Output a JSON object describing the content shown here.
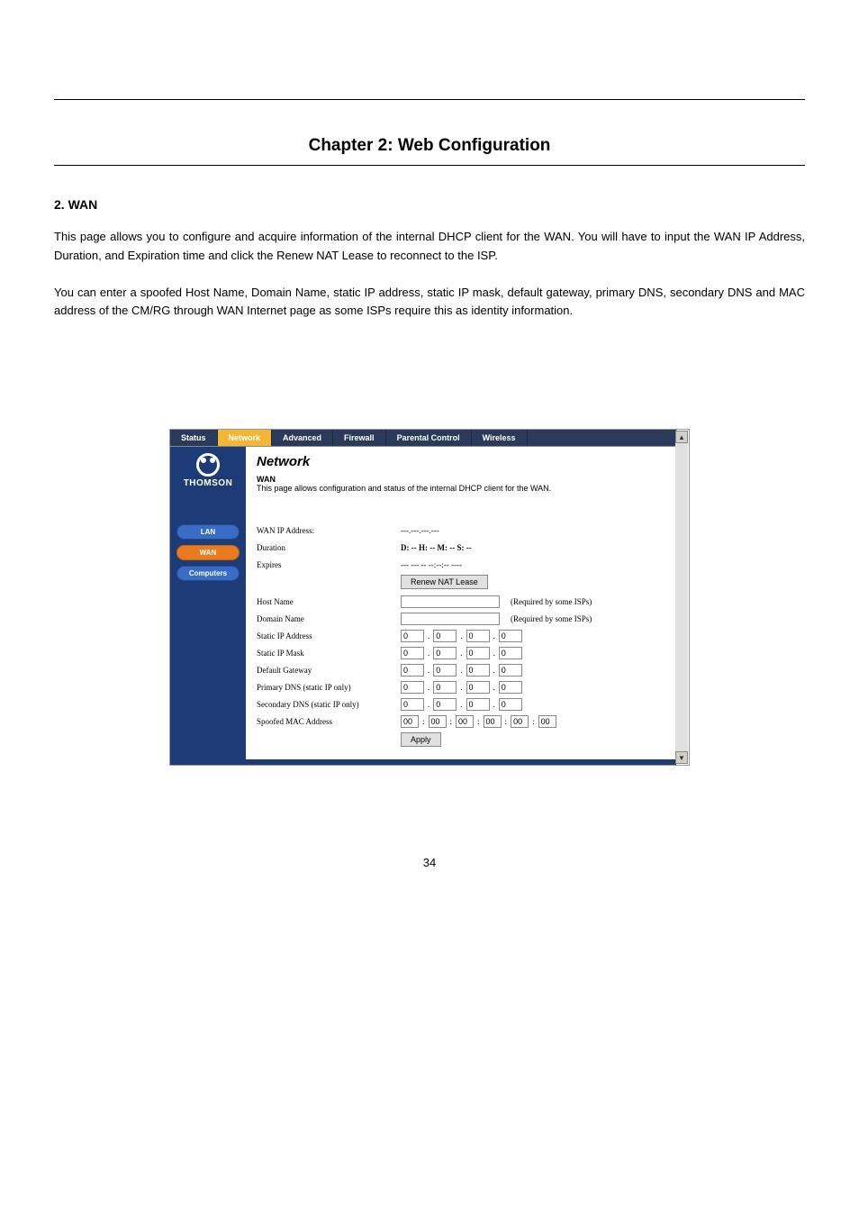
{
  "doc": {
    "chapter": "Chapter 2: Web Configuration",
    "section": "2. WAN",
    "para1": "This page allows you to configure and acquire information of the internal DHCP client for the WAN. You will have to input the WAN IP Address, Duration, and Expiration time and click the Renew NAT Lease to reconnect to the ISP.",
    "para2": "You can enter a spoofed Host Name, Domain Name, static IP address, static IP mask, default gateway, primary DNS, secondary DNS and MAC address of the CM/RG through WAN Internet page as some ISPs require this as identity information.",
    "page_num": "34"
  },
  "ss": {
    "scroll_up": "▲",
    "scroll_down": "▼",
    "tabs": {
      "t0": "Status",
      "t1": "Network",
      "t2": "Advanced",
      "t3": "Firewall",
      "t4": "Parental Control",
      "t5": "Wireless"
    },
    "logo": "THOMSON",
    "sidenav": {
      "lan": "LAN",
      "wan": "WAN",
      "computers": "Computers"
    },
    "heading": "Network",
    "sub_bold": "WAN",
    "sub_text": "This page allows configuration and status of the internal DHCP client for the WAN.",
    "labels": {
      "wan_ip": "WAN IP Address:",
      "duration": "Duration",
      "expires": "Expires",
      "host_name": "Host Name",
      "domain_name": "Domain Name",
      "static_ip": "Static IP Address",
      "static_mask": "Static IP Mask",
      "default_gw": "Default Gateway",
      "primary_dns": "Primary DNS (static IP only)",
      "secondary_dns": "Secondary DNS (static IP only)",
      "spoofed_mac": "Spoofed MAC Address"
    },
    "vals": {
      "wan_ip": "---.---.---.---",
      "duration": "D: -- H: -- M: -- S: --",
      "expires": "--- --- -- --:--:-- ----",
      "octet": "0",
      "hex": "00",
      "dot": ".",
      "colon": ":",
      "req_note": "(Required by some ISPs)"
    },
    "btns": {
      "renew": "Renew NAT Lease",
      "apply": "Apply"
    }
  }
}
